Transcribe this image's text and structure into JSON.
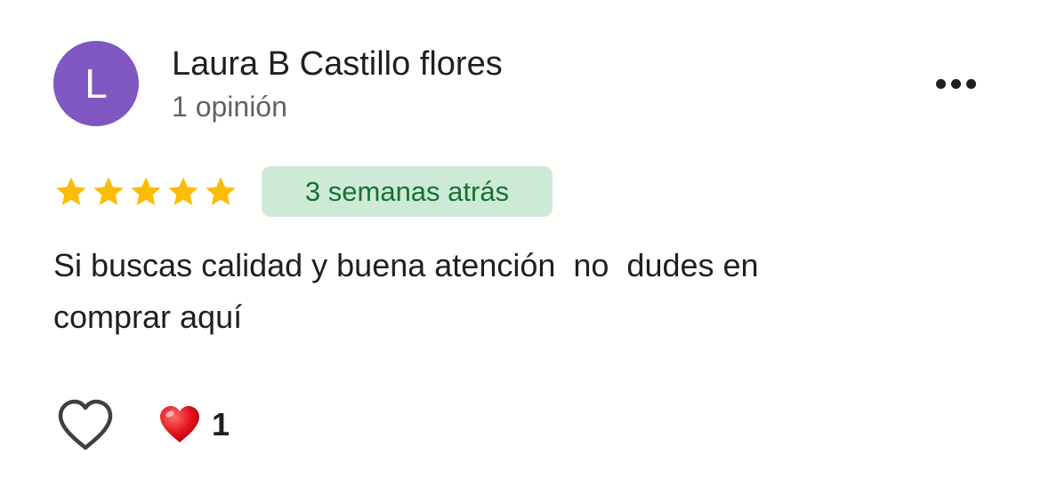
{
  "review": {
    "author": {
      "initial": "L",
      "name": "Laura B Castillo flores",
      "review_count": "1 opinión",
      "avatar_color": "#7e57c2"
    },
    "more_options_icon": "more-horizontal-icon",
    "rating": {
      "value": 5,
      "max": 5,
      "star_color": "#fbbc04"
    },
    "time_ago": "3 semanas atrás",
    "time_badge": {
      "background": "#ceead6",
      "text_color": "#137333"
    },
    "text": "Si buscas calidad y buena atención  no  dudes en\ncomprar aquí",
    "like_icon": "heart-outline-icon",
    "reaction": {
      "icon": "red-heart-icon",
      "count": "1"
    }
  }
}
